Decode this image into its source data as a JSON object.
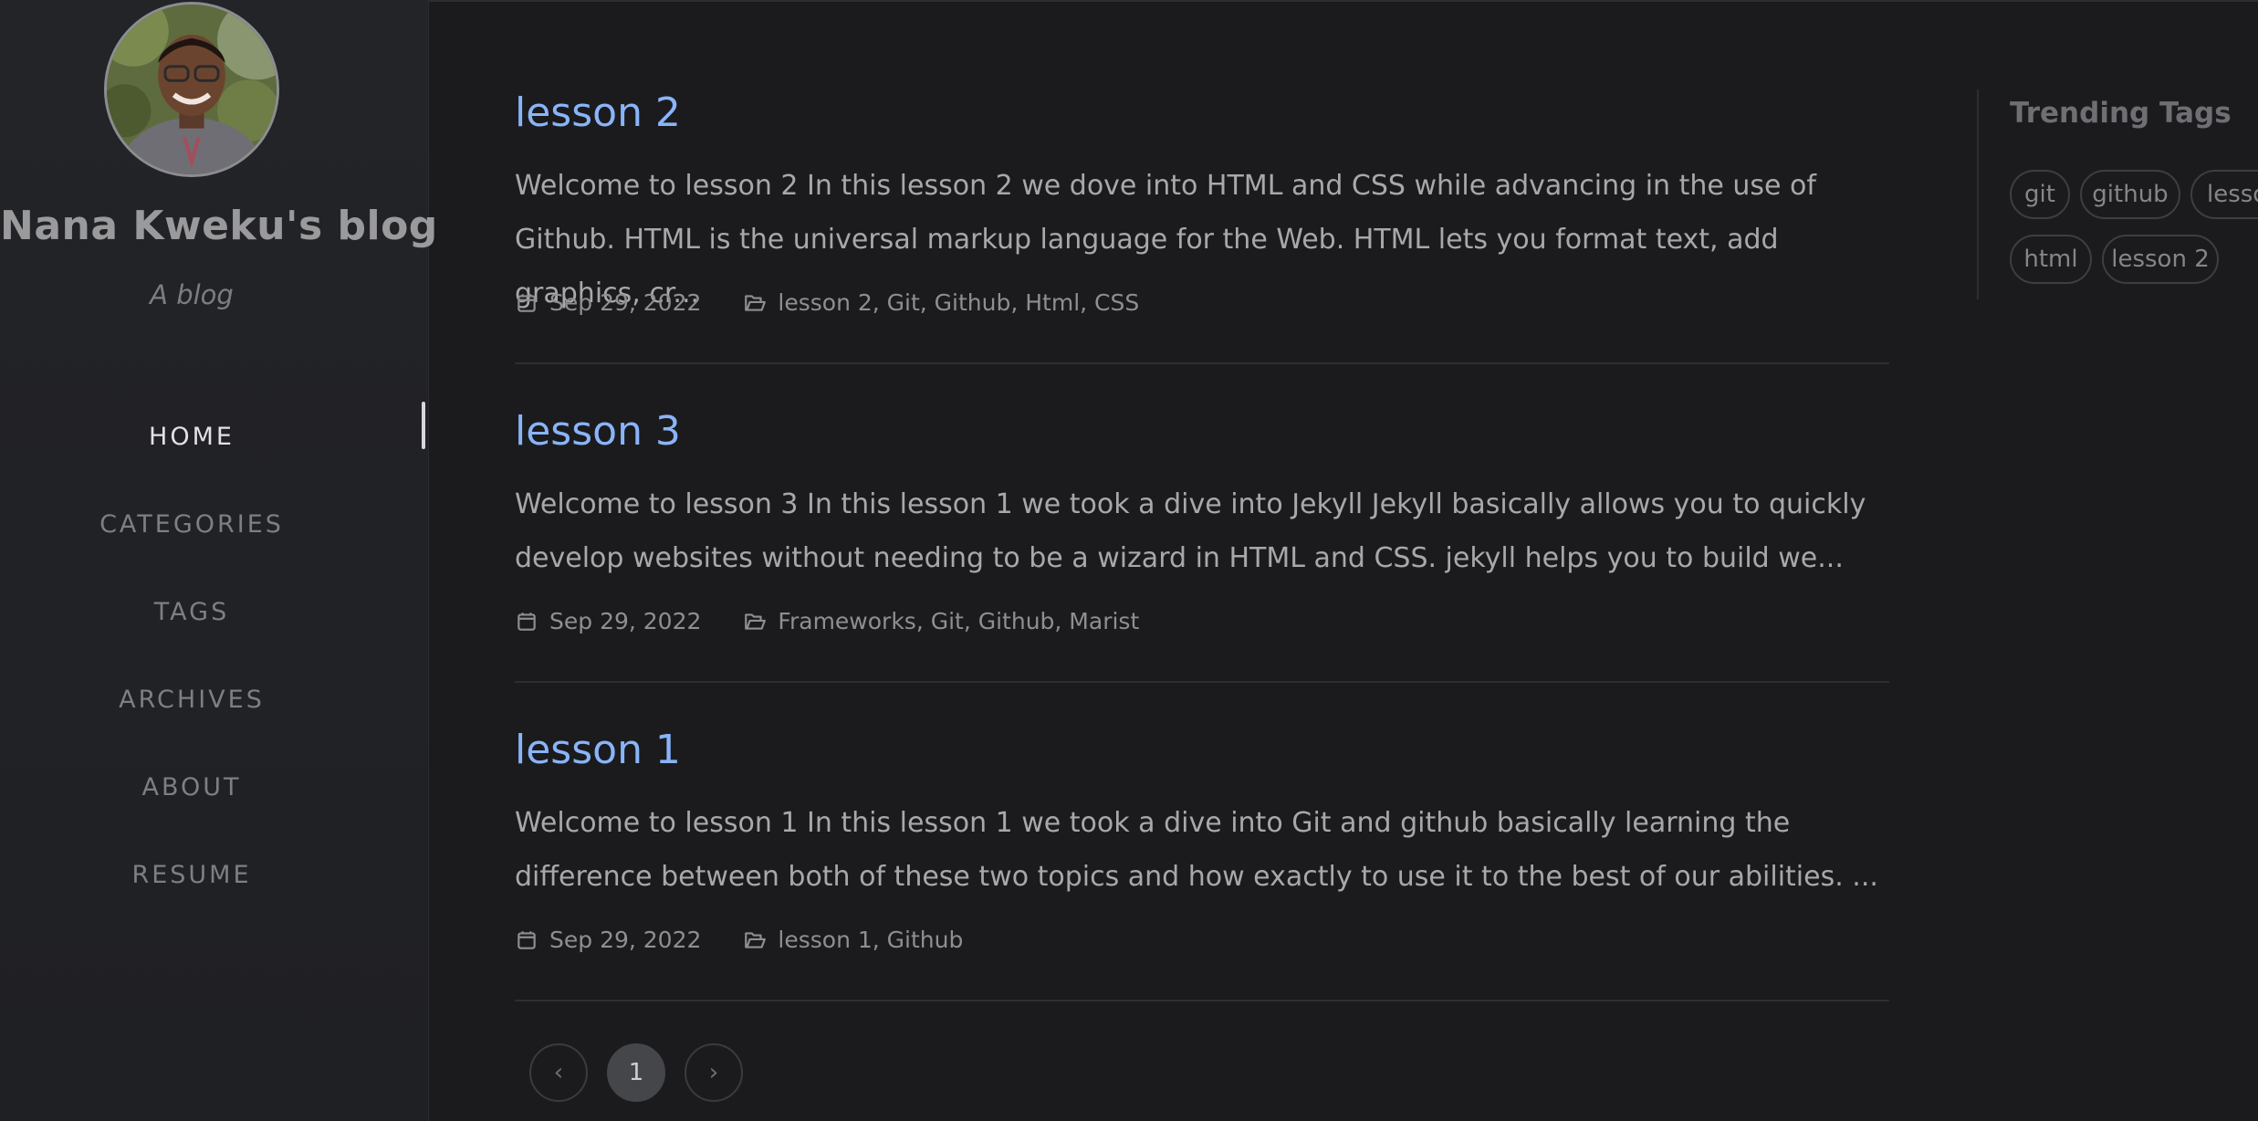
{
  "sidebar": {
    "site_title": "Nana Kweku's blog",
    "site_subtitle": "A blog",
    "nav": [
      {
        "label": "HOME",
        "active": true
      },
      {
        "label": "CATEGORIES"
      },
      {
        "label": "TAGS"
      },
      {
        "label": "ARCHIVES"
      },
      {
        "label": "ABOUT"
      },
      {
        "label": "RESUME"
      }
    ]
  },
  "posts": [
    {
      "title": "lesson 2",
      "excerpt": "Welcome to lesson 2 In this lesson 2 we dove into HTML and CSS while advancing in the use of Github. HTML is the universal markup language for the Web. HTML lets you format text, add graphics, cr...",
      "date": "Sep 29, 2022",
      "categories": "lesson 2, Git, Github, Html, CSS"
    },
    {
      "title": "lesson 3",
      "excerpt": "Welcome to lesson 3 In this lesson 1 we took a dive into Jekyll Jekyll basically allows you to quickly develop websites without needing to be a wizard in HTML and CSS. jekyll helps you to build we...",
      "date": "Sep 29, 2022",
      "categories": "Frameworks, Git, Github, Marist"
    },
    {
      "title": "lesson 1",
      "excerpt": "Welcome to lesson 1 In this lesson 1 we took a dive into Git and github basically learning the difference between both of these two topics and how exactly to use it to the best of our abilities. ...",
      "date": "Sep 29, 2022",
      "categories": "lesson 1, Github"
    }
  ],
  "pagination": {
    "prev": "‹",
    "current": "1",
    "next": "›"
  },
  "trending": {
    "title": "Trending Tags",
    "tags": [
      "git",
      "github",
      "lesso",
      "html",
      "lesson 2"
    ]
  },
  "icons": {
    "avatar": "profile-photo",
    "date": "calendar-icon",
    "categories": "folder-open-icon",
    "prev": "chevron-left-icon",
    "next": "chevron-right-icon"
  },
  "colors": {
    "background": "#1b1b1e",
    "sidebar": "#232428",
    "link": "#8ab4f8",
    "text": "#a8a8ab",
    "muted": "#8f8f92"
  }
}
